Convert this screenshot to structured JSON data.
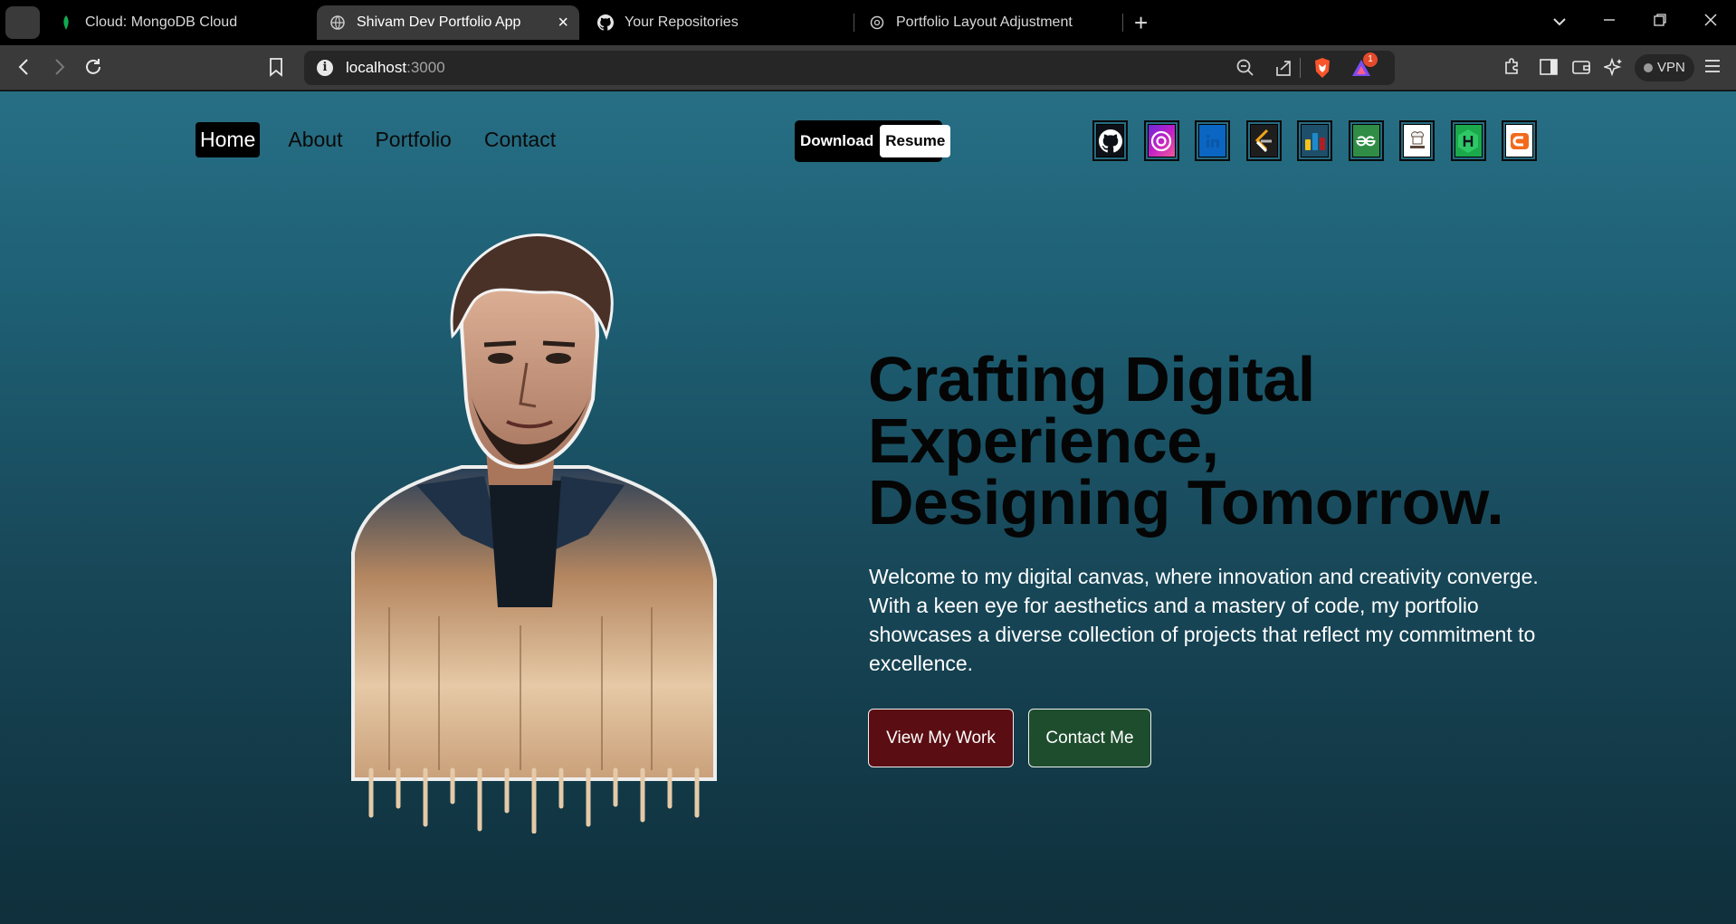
{
  "browser": {
    "tabs": [
      {
        "title": "Cloud: MongoDB Cloud",
        "active": false,
        "icon": "mongodb-leaf-icon"
      },
      {
        "title": "Shivam Dev Portfolio App",
        "active": true,
        "icon": "globe-icon"
      },
      {
        "title": "Your Repositories",
        "active": false,
        "icon": "github-icon"
      },
      {
        "title": "Portfolio Layout Adjustment",
        "active": false,
        "icon": "chatgpt-icon"
      }
    ],
    "new_tab": "+",
    "url_host": "localhost",
    "url_port": ":3000",
    "notification_count": "1",
    "vpn_label": "VPN"
  },
  "nav": {
    "home": "Home",
    "about": "About",
    "portfolio": "Portfolio",
    "contact": "Contact"
  },
  "resume_button": {
    "download": "Download",
    "resume": "Resume"
  },
  "socials": [
    "github-icon",
    "instagram-icon",
    "linkedin-icon",
    "leetcode-icon",
    "codeforces-icon",
    "geeksforgeeks-icon",
    "codechef-icon",
    "hackerrank-icon",
    "codingninjas-icon"
  ],
  "hero": {
    "title_line1": "Crafting Digital",
    "title_line2": "Experience,",
    "title_line3": "Designing Tomorrow.",
    "description": "Welcome to my digital canvas, where innovation and creativity converge. With a keen eye for aesthetics and a mastery of code, my portfolio showcases a diverse collection of projects that reflect my commitment to excellence.",
    "view_work": "View My Work",
    "contact_me": "Contact Me"
  },
  "colors": {
    "page_top": "#276f85",
    "page_bottom": "#0f2f3b",
    "view_work_bg": "#5a0d12",
    "contact_bg": "#1e4d2e"
  }
}
